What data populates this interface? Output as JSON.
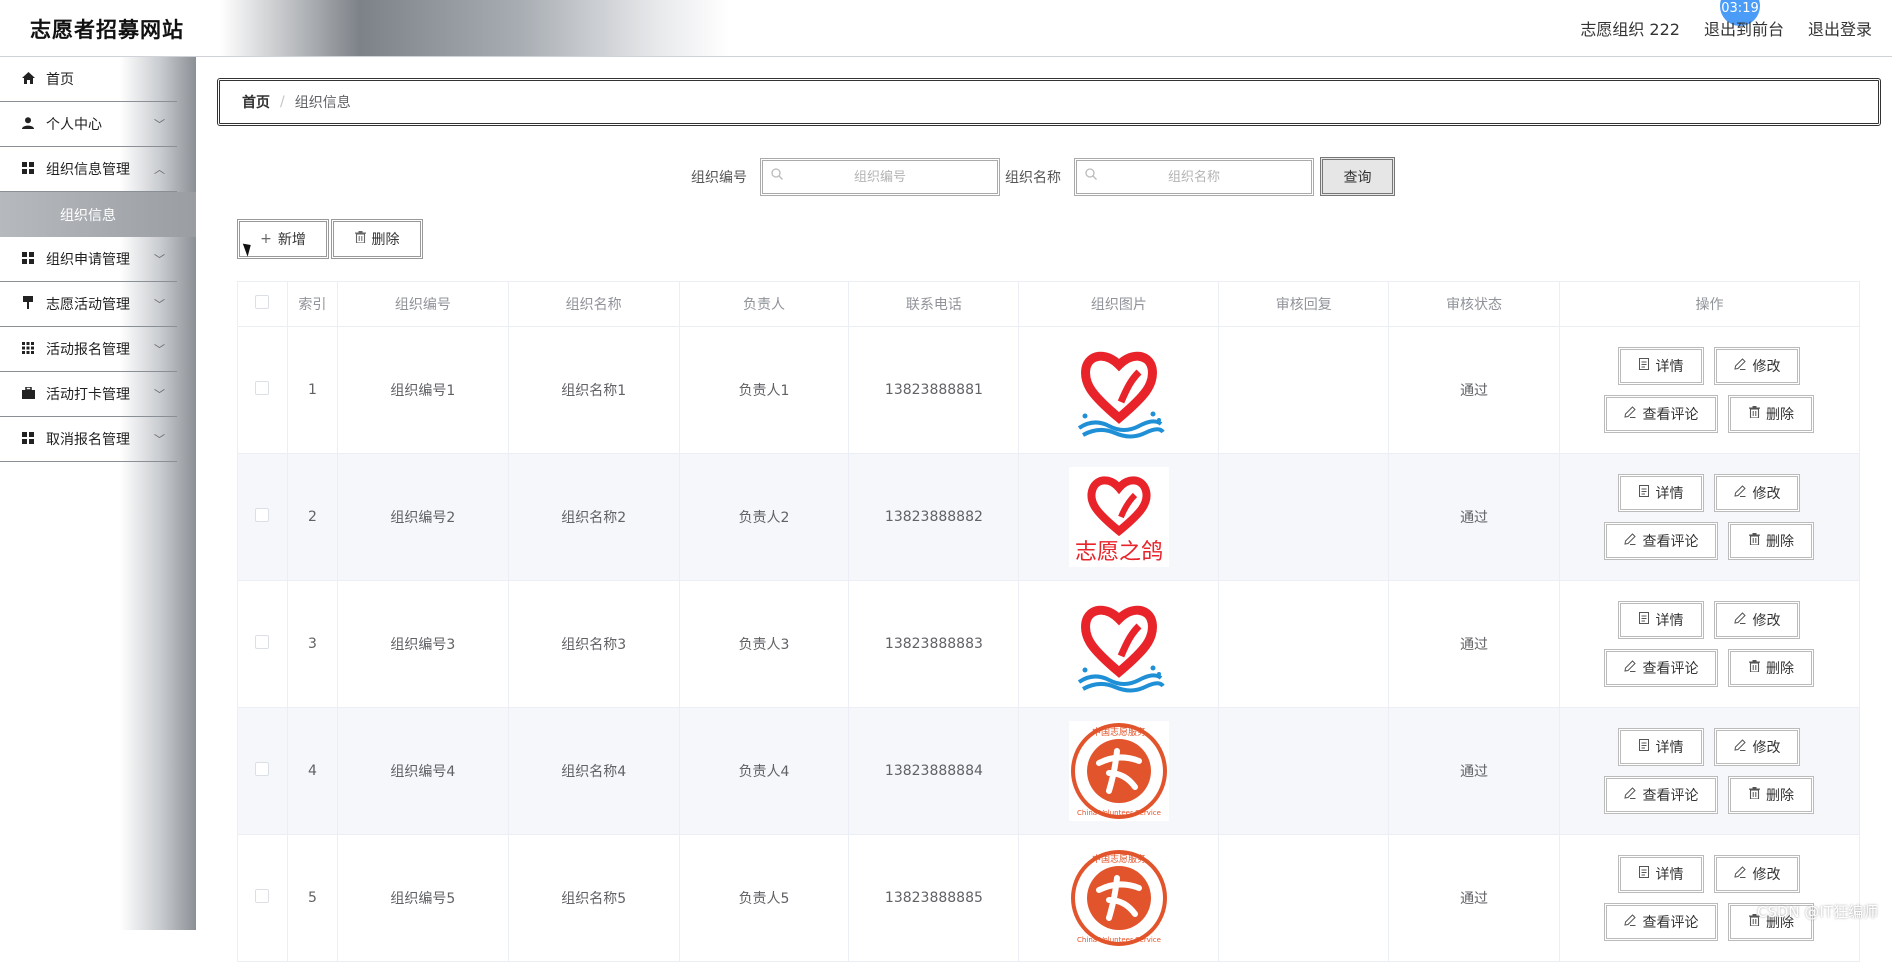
{
  "header": {
    "title": "志愿者招募网站",
    "user": "志愿组织 222",
    "to_front": "退出到前台",
    "logout": "退出登录",
    "timer": "03:19"
  },
  "sidebar": {
    "items": [
      {
        "label": "首页",
        "icon": "home-icon"
      },
      {
        "label": "个人中心",
        "icon": "user-icon"
      },
      {
        "label": "组织信息管理",
        "icon": "grid-icon"
      },
      {
        "label": "组织信息",
        "icon": ""
      },
      {
        "label": "组织申请管理",
        "icon": "grid-icon"
      },
      {
        "label": "志愿活动管理",
        "icon": "flag-icon"
      },
      {
        "label": "活动报名管理",
        "icon": "grid-icon"
      },
      {
        "label": "活动打卡管理",
        "icon": "briefcase-icon"
      },
      {
        "label": "取消报名管理",
        "icon": "grid-icon"
      }
    ]
  },
  "breadcrumb": {
    "home": "首页",
    "sep": "/",
    "current": "组织信息"
  },
  "search": {
    "org_no_label": "组织编号",
    "org_no_placeholder": "组织编号",
    "org_name_label": "组织名称",
    "org_name_placeholder": "组织名称",
    "query": "查询"
  },
  "actions": {
    "add": "新增",
    "delete": "删除"
  },
  "table": {
    "headers": [
      "",
      "索引",
      "组织编号",
      "组织名称",
      "负责人",
      "联系电话",
      "组织图片",
      "审核回复",
      "审核状态",
      "操作"
    ],
    "rows": [
      {
        "idx": "1",
        "no": "组织编号1",
        "name": "组织名称1",
        "leader": "负责人1",
        "phone": "13823888881",
        "image": "heart-wave-logo",
        "reply": "",
        "status": "通过"
      },
      {
        "idx": "2",
        "no": "组织编号2",
        "name": "组织名称2",
        "leader": "负责人2",
        "phone": "13823888882",
        "image": "heart-dove-logo",
        "reply": "",
        "status": "通过"
      },
      {
        "idx": "3",
        "no": "组织编号3",
        "name": "组织名称3",
        "leader": "负责人3",
        "phone": "13823888883",
        "image": "heart-wave-logo",
        "reply": "",
        "status": "通过"
      },
      {
        "idx": "4",
        "no": "组织编号4",
        "name": "组织名称4",
        "leader": "负责人4",
        "phone": "13823888884",
        "image": "china-volunteer-seal",
        "reply": "",
        "status": "通过"
      },
      {
        "idx": "5",
        "no": "组织编号5",
        "name": "组织名称5",
        "leader": "负责人5",
        "phone": "13823888885",
        "image": "china-volunteer-seal",
        "reply": "",
        "status": "通过"
      }
    ],
    "op": {
      "detail": "详情",
      "edit": "修改",
      "comments": "查看评论",
      "delete": "删除"
    }
  },
  "seal_text": {
    "top": "中国志愿服务",
    "bottom": "China Volunteer Service"
  },
  "logo_text": "志愿之鸽",
  "watermark": "CSDN @IT狂编师",
  "colors": {
    "accent": "#4a9cf7",
    "logo_red": "#e8232a",
    "wave_blue": "#1f8fd6",
    "seal_orange": "#e2542b"
  }
}
